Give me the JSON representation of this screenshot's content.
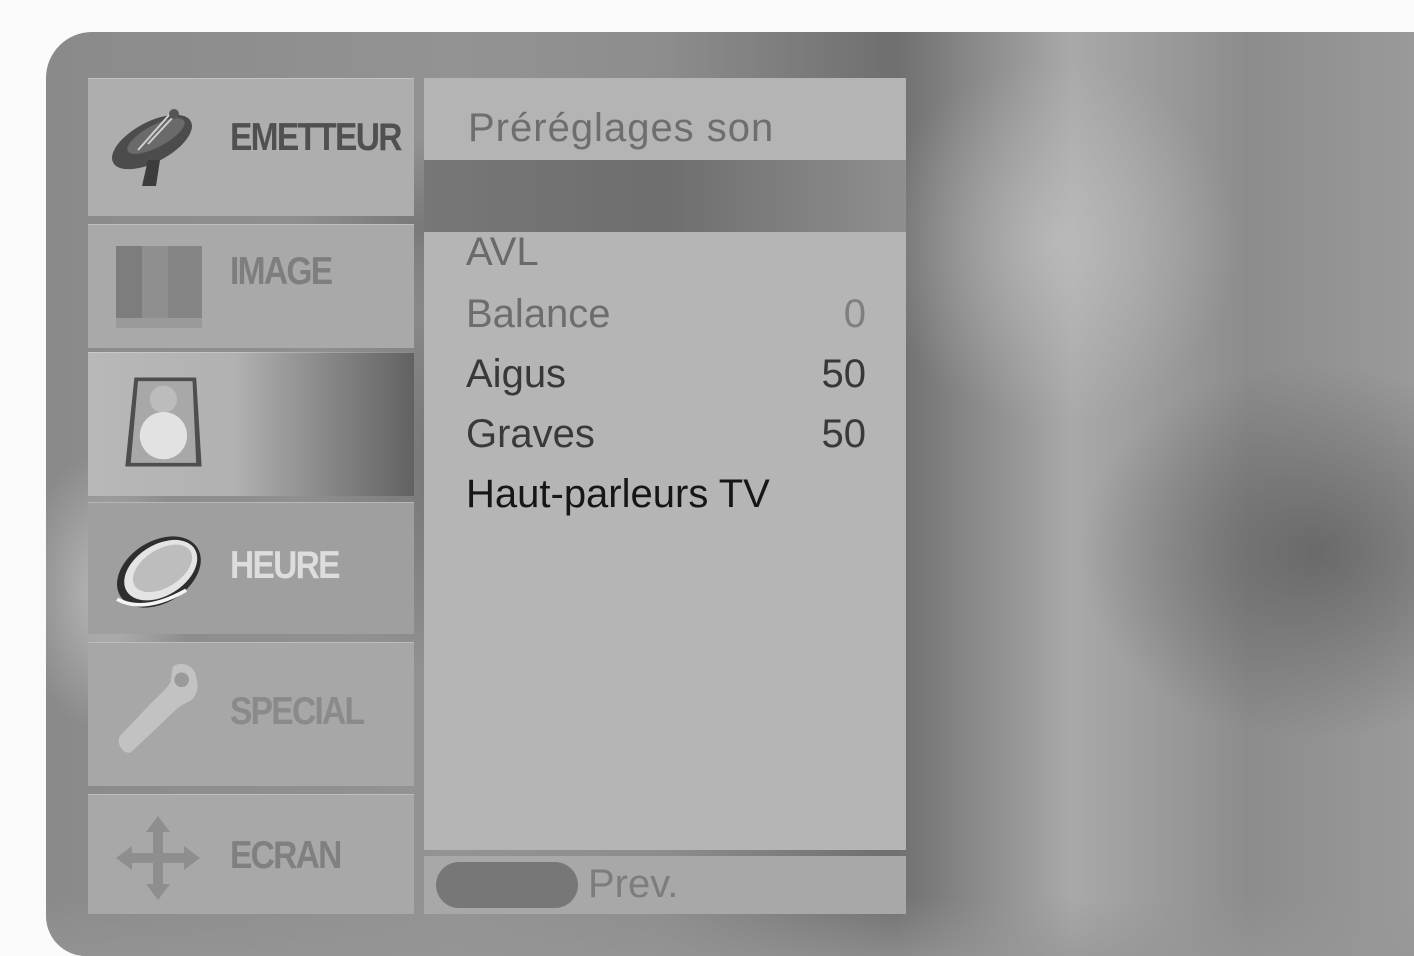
{
  "sidebar": {
    "items": [
      {
        "label": "EMETTEUR",
        "icon": "satellite-dish-icon"
      },
      {
        "label": "IMAGE",
        "icon": "picture-icon"
      },
      {
        "label": "",
        "icon": "speaker-icon"
      },
      {
        "label": "HEURE",
        "icon": "clock-icon"
      },
      {
        "label": "SPECIAL",
        "icon": "wrench-icon"
      },
      {
        "label": "ECRAN",
        "icon": "move-arrows-icon"
      }
    ]
  },
  "panel": {
    "title": "Préréglages son",
    "items": [
      {
        "label": "AVL",
        "value": ""
      },
      {
        "label": "Balance",
        "value": "0"
      },
      {
        "label": "Aigus",
        "value": "50"
      },
      {
        "label": "Graves",
        "value": "50"
      },
      {
        "label": "Haut-parleurs TV",
        "value": ""
      }
    ]
  },
  "footer": {
    "prev_label": "Prev."
  }
}
